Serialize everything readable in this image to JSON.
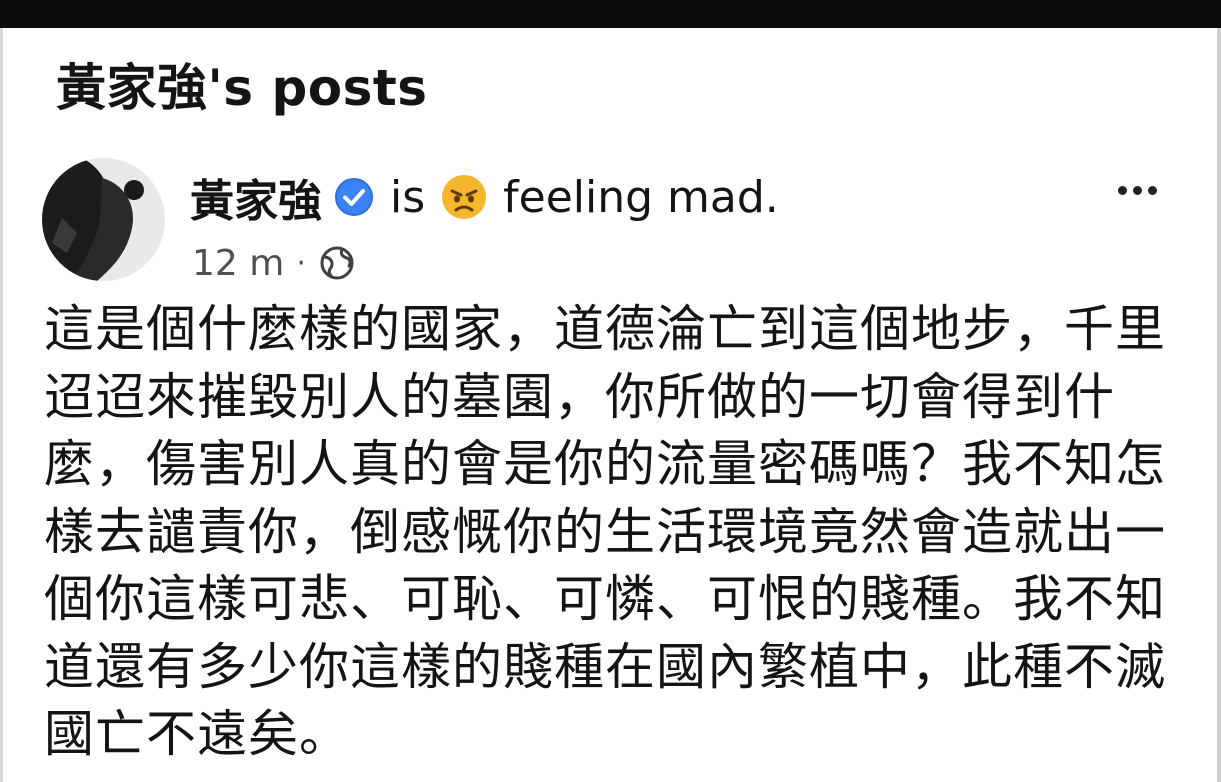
{
  "header": {
    "title": "黃家強's posts"
  },
  "post": {
    "author": "黃家強",
    "is_text": "is",
    "feeling_text": "feeling mad.",
    "time": "12 m",
    "separator": "·",
    "body": "這是個什麼樣的國家，道德淪亡到這個地步，千里迢迢來摧毀別人的墓園，你所做的一切會得到什麼，傷害別人真的會是你的流量密碼嗎？我不知怎樣去譴責你，倒感慨你的生活環境竟然會造就出一個你這樣可悲、可恥、可憐、可恨的賤種。我不知道還有多少你這樣的賤種在國內繁植中，此種不滅國亡不遠矣。"
  },
  "icons": {
    "verified": "verified-badge-icon",
    "feeling": "angry-face-emoji-icon",
    "privacy": "globe-icon",
    "more": "more-options-icon"
  },
  "colors": {
    "verified_blue": "#3b82f6",
    "emoji_yellow": "#f5b62e",
    "meta_gray": "#505050"
  }
}
